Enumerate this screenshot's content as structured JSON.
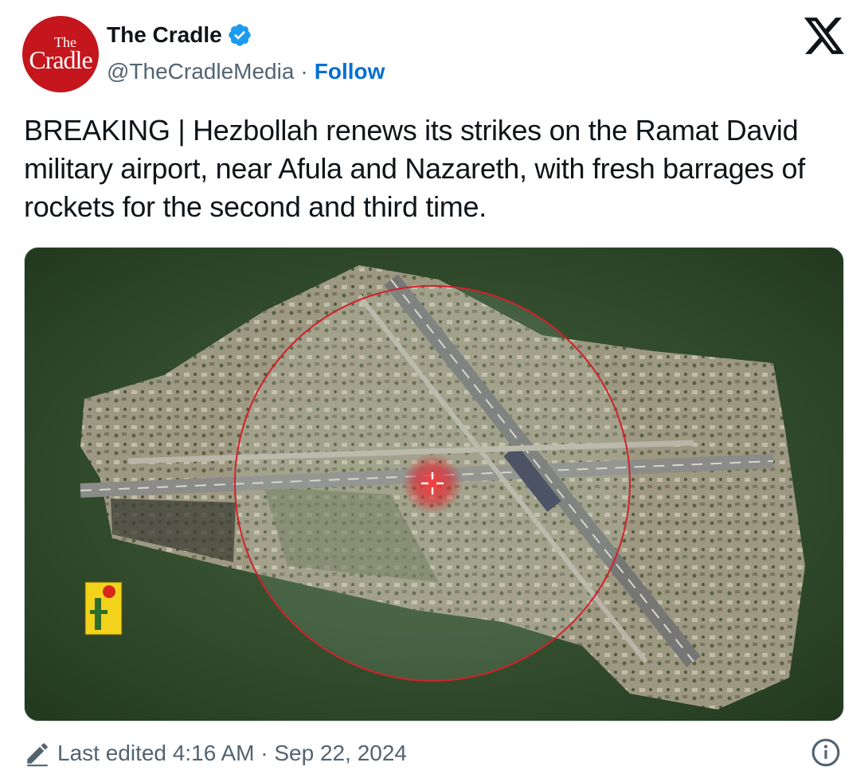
{
  "author": {
    "avatar_text_top": "The",
    "avatar_text_main": "Cradle",
    "display_name": "The Cradle",
    "handle": "@TheCradleMedia",
    "separator": "·",
    "follow_label": "Follow",
    "verified": true
  },
  "tweet": {
    "text": "BREAKING | Hezbollah renews its strikes on the Ramat David military airport, near Afula and Nazareth, with fresh barrages of rockets for the second and third time."
  },
  "media": {
    "description_icon": "satellite-image",
    "target_color": "#e0202a",
    "flag_color": "#f2d21b"
  },
  "footer": {
    "edited_text": "Last edited 4:16 AM · Sep 22, 2024"
  },
  "icons": {
    "close": "x-logo-icon",
    "verified": "verified-badge-icon",
    "edit": "pencil-icon",
    "info": "info-icon"
  }
}
